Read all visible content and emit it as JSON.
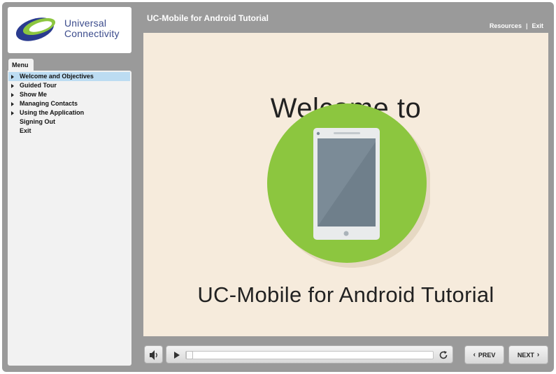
{
  "logo": {
    "line1": "Universal",
    "line2": "Connectivity",
    "colors": {
      "navy": "#2a3b8f",
      "green": "#8cc63f"
    }
  },
  "header": {
    "title": "UC-Mobile for Android Tutorial",
    "links": {
      "resources": "Resources",
      "separator": "|",
      "exit": "Exit"
    }
  },
  "menu": {
    "tab_label": "Menu",
    "items": [
      {
        "label": "Welcome and Objectives",
        "has_arrow": true,
        "selected": true
      },
      {
        "label": "Guided Tour",
        "has_arrow": true,
        "selected": false
      },
      {
        "label": "Show Me",
        "has_arrow": true,
        "selected": false
      },
      {
        "label": "Managing Contacts",
        "has_arrow": true,
        "selected": false
      },
      {
        "label": "Using the Application",
        "has_arrow": true,
        "selected": false
      },
      {
        "label": "Signing Out",
        "has_arrow": false,
        "selected": false
      },
      {
        "label": "Exit",
        "has_arrow": false,
        "selected": false
      }
    ]
  },
  "slide": {
    "heading": "Welcome to",
    "subheading": "UC-Mobile for Android Tutorial",
    "colors": {
      "background": "#f6ebdc",
      "circle": "#8cc63f",
      "phone_screen": "#7b8b97"
    },
    "icon": "android-phone-icon"
  },
  "player": {
    "volume_icon": "speaker-icon",
    "play_icon": "play-icon",
    "replay_icon": "replay-icon",
    "progress": 0.0,
    "prev_label": "PREV",
    "next_label": "NEXT",
    "prev_chevron": "‹",
    "next_chevron": "›"
  }
}
